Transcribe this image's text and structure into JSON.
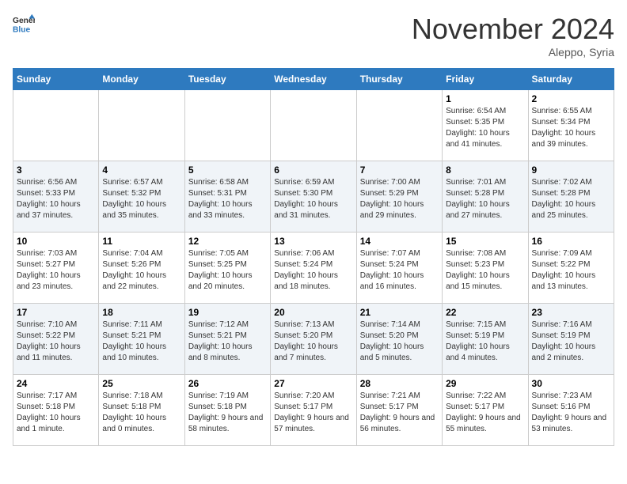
{
  "logo": {
    "line1": "General",
    "line2": "Blue"
  },
  "header": {
    "month": "November 2024",
    "location": "Aleppo, Syria"
  },
  "days_of_week": [
    "Sunday",
    "Monday",
    "Tuesday",
    "Wednesday",
    "Thursday",
    "Friday",
    "Saturday"
  ],
  "weeks": [
    [
      {
        "day": "",
        "info": ""
      },
      {
        "day": "",
        "info": ""
      },
      {
        "day": "",
        "info": ""
      },
      {
        "day": "",
        "info": ""
      },
      {
        "day": "",
        "info": ""
      },
      {
        "day": "1",
        "info": "Sunrise: 6:54 AM\nSunset: 5:35 PM\nDaylight: 10 hours and 41 minutes."
      },
      {
        "day": "2",
        "info": "Sunrise: 6:55 AM\nSunset: 5:34 PM\nDaylight: 10 hours and 39 minutes."
      }
    ],
    [
      {
        "day": "3",
        "info": "Sunrise: 6:56 AM\nSunset: 5:33 PM\nDaylight: 10 hours and 37 minutes."
      },
      {
        "day": "4",
        "info": "Sunrise: 6:57 AM\nSunset: 5:32 PM\nDaylight: 10 hours and 35 minutes."
      },
      {
        "day": "5",
        "info": "Sunrise: 6:58 AM\nSunset: 5:31 PM\nDaylight: 10 hours and 33 minutes."
      },
      {
        "day": "6",
        "info": "Sunrise: 6:59 AM\nSunset: 5:30 PM\nDaylight: 10 hours and 31 minutes."
      },
      {
        "day": "7",
        "info": "Sunrise: 7:00 AM\nSunset: 5:29 PM\nDaylight: 10 hours and 29 minutes."
      },
      {
        "day": "8",
        "info": "Sunrise: 7:01 AM\nSunset: 5:28 PM\nDaylight: 10 hours and 27 minutes."
      },
      {
        "day": "9",
        "info": "Sunrise: 7:02 AM\nSunset: 5:28 PM\nDaylight: 10 hours and 25 minutes."
      }
    ],
    [
      {
        "day": "10",
        "info": "Sunrise: 7:03 AM\nSunset: 5:27 PM\nDaylight: 10 hours and 23 minutes."
      },
      {
        "day": "11",
        "info": "Sunrise: 7:04 AM\nSunset: 5:26 PM\nDaylight: 10 hours and 22 minutes."
      },
      {
        "day": "12",
        "info": "Sunrise: 7:05 AM\nSunset: 5:25 PM\nDaylight: 10 hours and 20 minutes."
      },
      {
        "day": "13",
        "info": "Sunrise: 7:06 AM\nSunset: 5:24 PM\nDaylight: 10 hours and 18 minutes."
      },
      {
        "day": "14",
        "info": "Sunrise: 7:07 AM\nSunset: 5:24 PM\nDaylight: 10 hours and 16 minutes."
      },
      {
        "day": "15",
        "info": "Sunrise: 7:08 AM\nSunset: 5:23 PM\nDaylight: 10 hours and 15 minutes."
      },
      {
        "day": "16",
        "info": "Sunrise: 7:09 AM\nSunset: 5:22 PM\nDaylight: 10 hours and 13 minutes."
      }
    ],
    [
      {
        "day": "17",
        "info": "Sunrise: 7:10 AM\nSunset: 5:22 PM\nDaylight: 10 hours and 11 minutes."
      },
      {
        "day": "18",
        "info": "Sunrise: 7:11 AM\nSunset: 5:21 PM\nDaylight: 10 hours and 10 minutes."
      },
      {
        "day": "19",
        "info": "Sunrise: 7:12 AM\nSunset: 5:21 PM\nDaylight: 10 hours and 8 minutes."
      },
      {
        "day": "20",
        "info": "Sunrise: 7:13 AM\nSunset: 5:20 PM\nDaylight: 10 hours and 7 minutes."
      },
      {
        "day": "21",
        "info": "Sunrise: 7:14 AM\nSunset: 5:20 PM\nDaylight: 10 hours and 5 minutes."
      },
      {
        "day": "22",
        "info": "Sunrise: 7:15 AM\nSunset: 5:19 PM\nDaylight: 10 hours and 4 minutes."
      },
      {
        "day": "23",
        "info": "Sunrise: 7:16 AM\nSunset: 5:19 PM\nDaylight: 10 hours and 2 minutes."
      }
    ],
    [
      {
        "day": "24",
        "info": "Sunrise: 7:17 AM\nSunset: 5:18 PM\nDaylight: 10 hours and 1 minute."
      },
      {
        "day": "25",
        "info": "Sunrise: 7:18 AM\nSunset: 5:18 PM\nDaylight: 10 hours and 0 minutes."
      },
      {
        "day": "26",
        "info": "Sunrise: 7:19 AM\nSunset: 5:18 PM\nDaylight: 9 hours and 58 minutes."
      },
      {
        "day": "27",
        "info": "Sunrise: 7:20 AM\nSunset: 5:17 PM\nDaylight: 9 hours and 57 minutes."
      },
      {
        "day": "28",
        "info": "Sunrise: 7:21 AM\nSunset: 5:17 PM\nDaylight: 9 hours and 56 minutes."
      },
      {
        "day": "29",
        "info": "Sunrise: 7:22 AM\nSunset: 5:17 PM\nDaylight: 9 hours and 55 minutes."
      },
      {
        "day": "30",
        "info": "Sunrise: 7:23 AM\nSunset: 5:16 PM\nDaylight: 9 hours and 53 minutes."
      }
    ]
  ]
}
